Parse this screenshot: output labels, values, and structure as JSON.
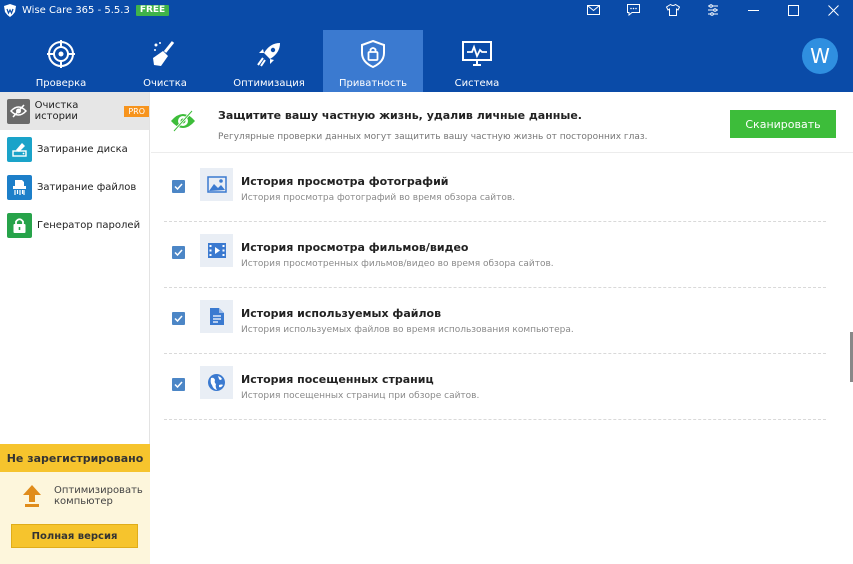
{
  "app": {
    "title": "Wise Care 365 - 5.5.3",
    "badge": "FREE",
    "accent": "#0a4ba8",
    "active_tab": "#3b7ad0"
  },
  "titlebar_icons": [
    "mail-icon",
    "feedback-icon",
    "skin-icon",
    "settings-icon",
    "minimize-icon",
    "maximize-icon",
    "close-icon"
  ],
  "nav": {
    "items": [
      {
        "label": "Проверка",
        "icon": "radar-icon"
      },
      {
        "label": "Очистка",
        "icon": "broom-icon"
      },
      {
        "label": "Оптимизация",
        "icon": "rocket-icon"
      },
      {
        "label": "Приватность",
        "icon": "lock-shield-icon"
      },
      {
        "label": "Система",
        "icon": "monitor-icon"
      }
    ],
    "avatar": "W"
  },
  "sidebar": {
    "items": [
      {
        "label": "Очистка истории",
        "badge": "PRO",
        "color": "#6a6a6a"
      },
      {
        "label": "Затирание диска",
        "color": "#1aa3c9"
      },
      {
        "label": "Затирание файлов",
        "color": "#1d7fc9"
      },
      {
        "label": "Генератор паролей",
        "color": "#27a34a"
      }
    ],
    "unregistered": {
      "title": "Не зарегистрировано",
      "optimize_text_1": "Оптимизировать",
      "optimize_text_2": "компьютер",
      "full_version": "Полная версия"
    }
  },
  "banner": {
    "title": "Защитите вашу частную жизнь, удалив личные данные.",
    "subtitle": "Регулярные проверки данных могут защитить вашу частную жизнь от посторонних глаз.",
    "scan_button": "Сканировать"
  },
  "rows": [
    {
      "title": "История просмотра фотографий",
      "desc": "История просмотра фотографий во время обзора сайтов.",
      "checked": true,
      "icon": "image-icon"
    },
    {
      "title": "История просмотра фильмов/видео",
      "desc": "История просмотренных фильмов/видео во время обзора сайтов.",
      "checked": true,
      "icon": "film-icon"
    },
    {
      "title": "История используемых файлов",
      "desc": "История используемых файлов во время использования компьютера.",
      "checked": true,
      "icon": "document-icon"
    },
    {
      "title": "История посещенных страниц",
      "desc": "История посещенных страниц при обзоре сайтов.",
      "checked": true,
      "icon": "globe-icon"
    }
  ]
}
